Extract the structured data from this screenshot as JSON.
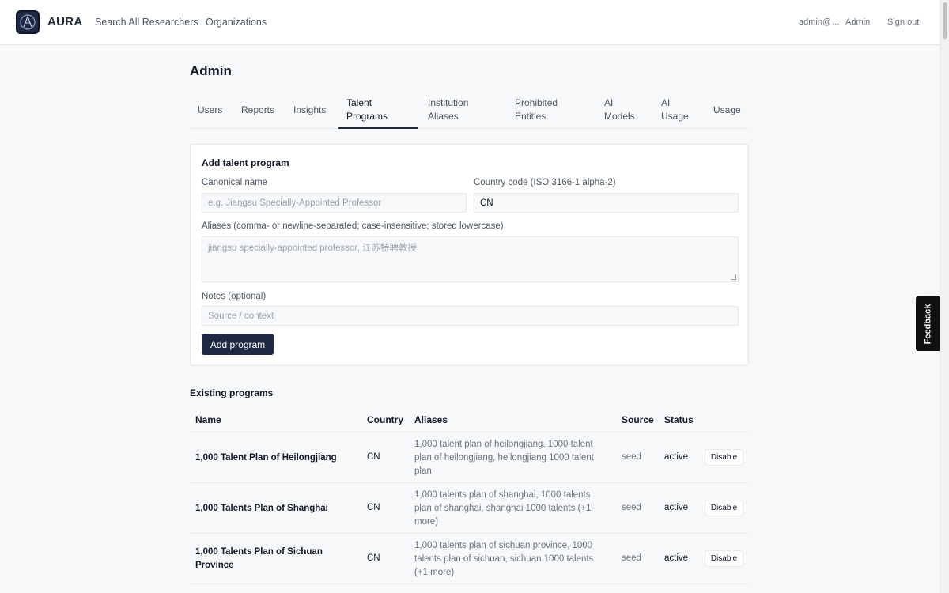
{
  "header": {
    "brand": "AURA",
    "nav": [
      "Search All Researchers",
      "Organizations"
    ],
    "user_email": "admin@…",
    "admin_link": "Admin",
    "sign_out": "Sign out"
  },
  "page": {
    "title": "Admin"
  },
  "tabs": [
    {
      "label": "Users",
      "active": false
    },
    {
      "label": "Reports",
      "active": false
    },
    {
      "label": "Insights",
      "active": false
    },
    {
      "label": "Talent Programs",
      "active": true
    },
    {
      "label": "Institution Aliases",
      "active": false
    },
    {
      "label": "Prohibited Entities",
      "active": false
    },
    {
      "label": "AI Models",
      "active": false
    },
    {
      "label": "AI Usage",
      "active": false
    },
    {
      "label": "Usage",
      "active": false
    }
  ],
  "form": {
    "title": "Add talent program",
    "canonical_name_label": "Canonical name",
    "canonical_name_placeholder": "e.g. Jiangsu Specially-Appointed Professor",
    "country_code_label": "Country code (ISO 3166-1 alpha-2)",
    "country_code_value": "CN",
    "aliases_label": "Aliases (comma- or newline-separated; case-insensitive; stored lowercase)",
    "aliases_placeholder": "jiangsu specially-appointed professor, 江苏特聘教授",
    "notes_label": "Notes (optional)",
    "notes_placeholder": "Source / context",
    "submit_label": "Add program"
  },
  "programs": {
    "title": "Existing programs",
    "columns": {
      "name": "Name",
      "country": "Country",
      "aliases": "Aliases",
      "source": "Source",
      "status": "Status"
    },
    "rows": [
      {
        "name": "1,000 Talent Plan of Heilongjiang",
        "country": "CN",
        "aliases": "1,000 talent plan of heilongjiang, 1000 talent plan of heilongjiang, heilongjiang 1000 talent plan",
        "source": "seed",
        "status": "active",
        "action": "Disable"
      },
      {
        "name": "1,000 Talents Plan of Shanghai",
        "country": "CN",
        "aliases": "1,000 talents plan of shanghai, 1000 talents plan of shanghai, shanghai 1000 talents (+1 more)",
        "source": "seed",
        "status": "active",
        "action": "Disable"
      },
      {
        "name": "1,000 Talents Plan of Sichuan Province",
        "country": "CN",
        "aliases": "1,000 talents plan of sichuan province, 1000 talents plan of sichuan, sichuan 1000 talents (+1 more)",
        "source": "seed",
        "status": "active",
        "action": "Disable"
      }
    ]
  },
  "feedback": {
    "label": "Feedback"
  },
  "colors": {
    "primary": "#1e2a44",
    "background": "#f7f8fa",
    "border": "#e5e7eb"
  }
}
